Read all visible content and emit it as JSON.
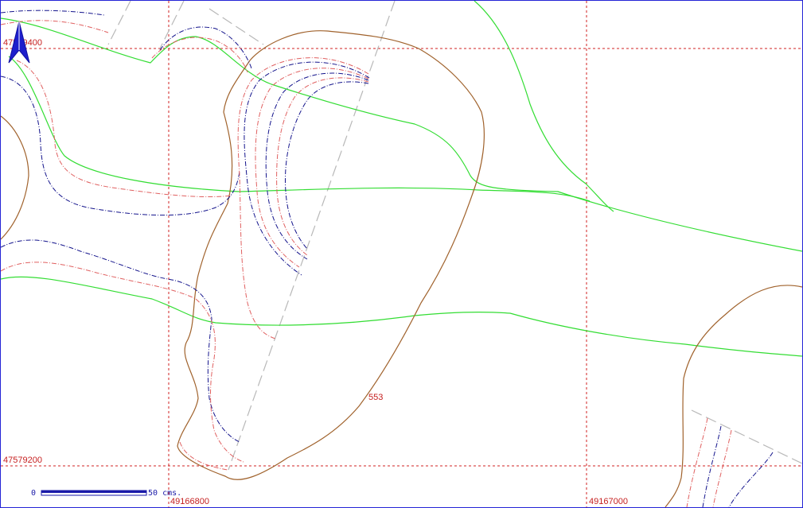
{
  "map": {
    "colors": {
      "grid": "#d22222",
      "contour_main": "#a0622c",
      "contour_green": "#33dd33",
      "isobath_blue": "#14148c",
      "isobath_red": "#e06060",
      "road_gray": "#b8b8b8",
      "frame": "#2323d6"
    },
    "grid_labels": {
      "northing_top": "47579400",
      "northing_bottom": "47579200",
      "easting_left": "49166800",
      "easting_right": "49167000"
    },
    "contour_label": "553",
    "north_arrow": {
      "icon": "north-arrow-icon"
    },
    "scale_bar": {
      "start": "0",
      "end": "50",
      "unit": "cms."
    }
  }
}
